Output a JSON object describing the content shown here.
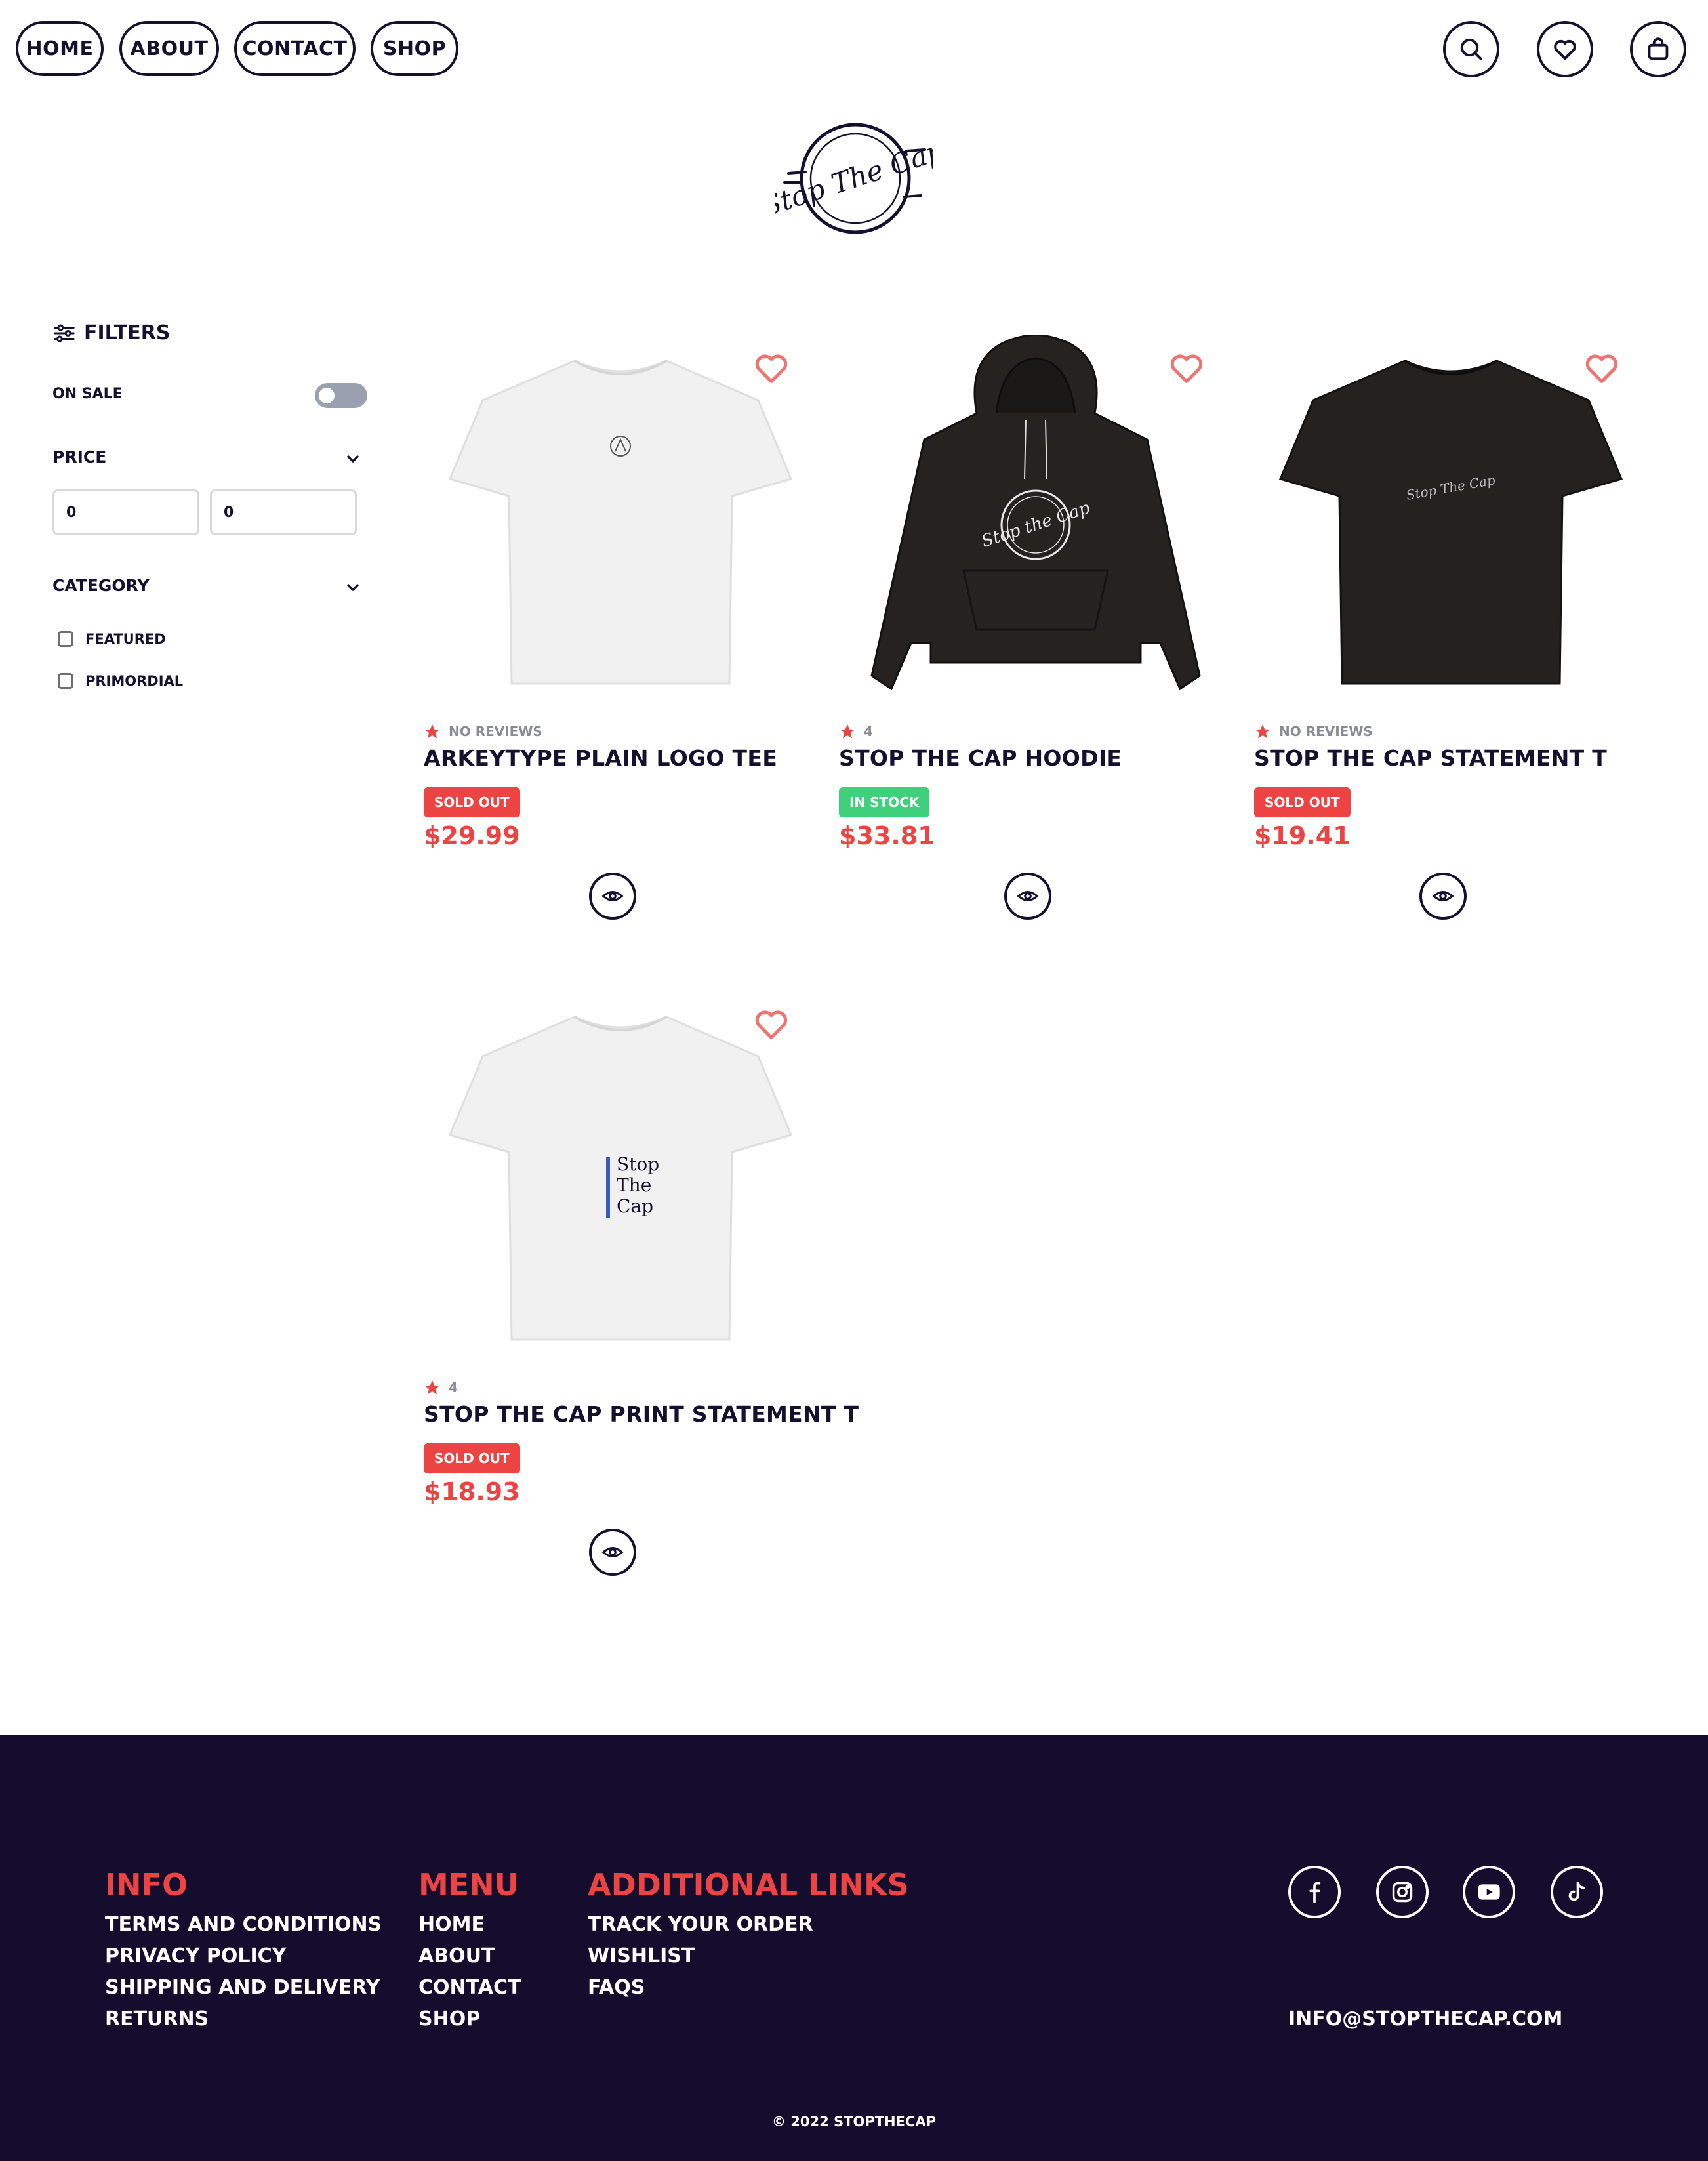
{
  "header": {
    "nav": [
      "HOME",
      "ABOUT",
      "CONTACT",
      "SHOP"
    ],
    "icons": [
      "search-icon",
      "heart-icon",
      "bag-icon"
    ]
  },
  "logo": {
    "text": "Stop The Cap"
  },
  "filters": {
    "title": "FILTERS",
    "on_sale_label": "ON SALE",
    "on_sale": false,
    "price_label": "PRICE",
    "price_min": "0",
    "price_max": "0",
    "category_label": "CATEGORY",
    "categories": [
      "FEATURED",
      "PRIMORDIAL"
    ]
  },
  "products": [
    {
      "rating": "NO REVIEWS",
      "title": "ARKEYTYPE PLAIN LOGO TEE",
      "status": "SOLD OUT",
      "price": "$29.99"
    },
    {
      "rating": "4",
      "title": "STOP THE CAP HOODIE",
      "status": "IN STOCK",
      "price": "$33.81"
    },
    {
      "rating": "NO REVIEWS",
      "title": "STOP THE CAP STATEMENT T",
      "status": "SOLD OUT",
      "price": "$19.41"
    },
    {
      "rating": "4",
      "title": "STOP THE CAP PRINT STATEMENT T",
      "status": "SOLD OUT",
      "price": "$18.93",
      "print_lines": [
        "Stop",
        "The",
        "Cap"
      ]
    }
  ],
  "footer": {
    "info": {
      "heading": "INFO",
      "links": [
        "TERMS AND CONDITIONS",
        "PRIVACY POLICY",
        "SHIPPING AND DELIVERY",
        "RETURNS"
      ]
    },
    "menu": {
      "heading": "MENU",
      "links": [
        "HOME",
        "ABOUT",
        "CONTACT",
        "SHOP"
      ]
    },
    "additional": {
      "heading": "ADDITIONAL LINKS",
      "links": [
        "TRACK YOUR ORDER",
        "WISHLIST",
        "FAQS"
      ]
    },
    "social": [
      "facebook-icon",
      "instagram-icon",
      "youtube-icon",
      "tiktok-icon"
    ],
    "email": "INFO@STOPTHECAP.COM",
    "copyright": "© 2022 STOPTHECAP"
  },
  "colors": {
    "navy": "#15102e",
    "red": "#ee4343",
    "green": "#3ed07a",
    "heart": "#f07373",
    "footer_bg": "#150d2e"
  }
}
